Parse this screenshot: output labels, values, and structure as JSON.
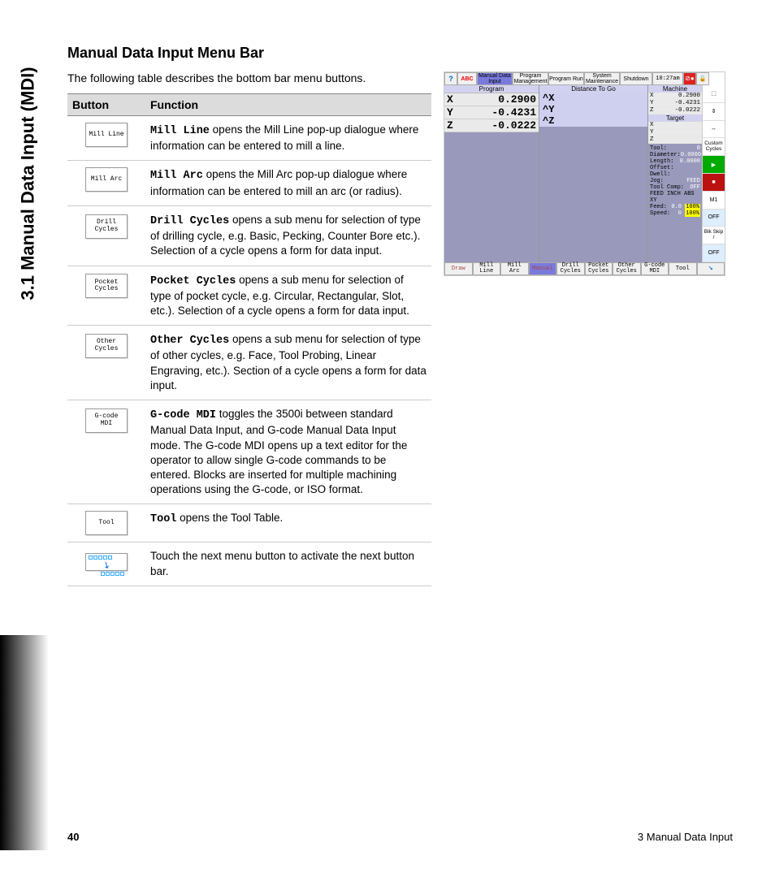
{
  "section_tab": "3.1 Manual Data Input (MDI)",
  "heading": "Manual Data Input Menu Bar",
  "intro": "The following table describes the bottom bar menu buttons.",
  "table": {
    "headers": {
      "button": "Button",
      "function": "Function"
    },
    "rows": [
      {
        "btn_l1": "Mill Line",
        "btn_l2": "",
        "name": "Mill Line",
        "desc": " opens the Mill Line pop-up dialogue where information can be entered to mill a line."
      },
      {
        "btn_l1": "Mill Arc",
        "btn_l2": "",
        "name": "Mill Arc",
        "desc": " opens the Mill Arc pop-up dialogue where information can be entered to mill an arc (or radius)."
      },
      {
        "btn_l1": "Drill",
        "btn_l2": "Cycles",
        "name": "Drill Cycles",
        "desc": " opens a sub menu for selection of type of drilling cycle, e.g. Basic, Pecking, Counter Bore etc.).  Selection of a cycle opens a form for data input."
      },
      {
        "btn_l1": "Pocket",
        "btn_l2": "Cycles",
        "name": "Pocket Cycles",
        "desc": " opens a sub menu for selection of type of pocket cycle, e.g. Circular, Rectangular, Slot, etc.).  Selection of a cycle opens a form for data input."
      },
      {
        "btn_l1": "Other",
        "btn_l2": "Cycles",
        "name": "Other Cycles",
        "desc": " opens a sub menu for selection of type of other cycles, e.g. Face, Tool Probing, Linear Engraving, etc.).  Section of a cycle opens a form for data input."
      },
      {
        "btn_l1": "G-code",
        "btn_l2": "MDI",
        "name": "G-code MDI",
        "desc": " toggles the 3500i between standard Manual Data Input, and G-code Manual Data Input mode. The G-code MDI opens up a text editor for the operator to allow single G-code commands to be entered.  Blocks are inserted for multiple machining operations using the G-code, or ISO format."
      },
      {
        "btn_l1": "Tool",
        "btn_l2": "",
        "name": "Tool",
        "desc": " opens the Tool Table."
      }
    ],
    "next_row": {
      "desc": "Touch the next menu button to activate the next button bar."
    }
  },
  "screenshot": {
    "topbar": {
      "help": "?",
      "abc": "ABC",
      "mdi_l1": "Manual Data",
      "mdi_l2": "Input",
      "pm_l1": "Program",
      "pm_l2": "Management",
      "pr": "Program Run",
      "sm_l1": "System",
      "sm_l2": "Maintenance",
      "shutdown": "Shutdown",
      "time": "10:27am",
      "alert": "⊘",
      "lock": "🔓"
    },
    "program_hdr": "Program",
    "coords": [
      {
        "ax": "X",
        "val": "0.2900"
      },
      {
        "ax": "Y",
        "val": "-0.4231"
      },
      {
        "ax": "Z",
        "val": "-0.0222"
      }
    ],
    "dtgo_hdr": "Distance To Go",
    "dtgo": [
      {
        "ax": "^X"
      },
      {
        "ax": "^Y"
      },
      {
        "ax": "^Z"
      }
    ],
    "machine_hdr": "Machine",
    "machine": [
      {
        "ax": "X",
        "val": "0.2900"
      },
      {
        "ax": "Y",
        "val": "-0.4231"
      },
      {
        "ax": "Z",
        "val": "-0.0222"
      }
    ],
    "target_hdr": "Target",
    "target": [
      {
        "ax": "X"
      },
      {
        "ax": "Y"
      },
      {
        "ax": "Z"
      }
    ],
    "info": [
      {
        "lab": "Tool:",
        "val": "0"
      },
      {
        "lab": "Diameter:",
        "val": "0.0000"
      },
      {
        "lab": "Length:",
        "val": "0.0000"
      },
      {
        "lab": "Offset:",
        "val": ""
      },
      {
        "lab": "Dwell:",
        "val": ""
      },
      {
        "lab": "Jog:",
        "val": "FEED"
      },
      {
        "lab": "Tool Comp:",
        "val": "OFF"
      },
      {
        "lab": "FEED  INCH  ABS  XY",
        "val": ""
      },
      {
        "lab": "Feed:",
        "val": "0.0",
        "pct": "100%"
      },
      {
        "lab": "Speed:",
        "val": "0",
        "pct": "100%"
      }
    ],
    "side_icons": {
      "cust_cycles": "Custom Cycles",
      "m1": "M1",
      "off1": "OFF",
      "blk_skip": "Blk Skip /",
      "off2": "OFF"
    },
    "bottombar": {
      "draw": "Draw",
      "mill_line": "Mill Line",
      "mill_arc": "Mill Arc",
      "manual": "Manual",
      "drill_l1": "Drill",
      "drill_l2": "Cycles",
      "pocket_l1": "Pocket",
      "pocket_l2": "Cycles",
      "other_l1": "Other",
      "other_l2": "Cycles",
      "gcode_l1": "G-code",
      "gcode_l2": "MDI",
      "tool": "Tool"
    }
  },
  "footer": {
    "page": "40",
    "chapter": "3 Manual Data Input"
  }
}
